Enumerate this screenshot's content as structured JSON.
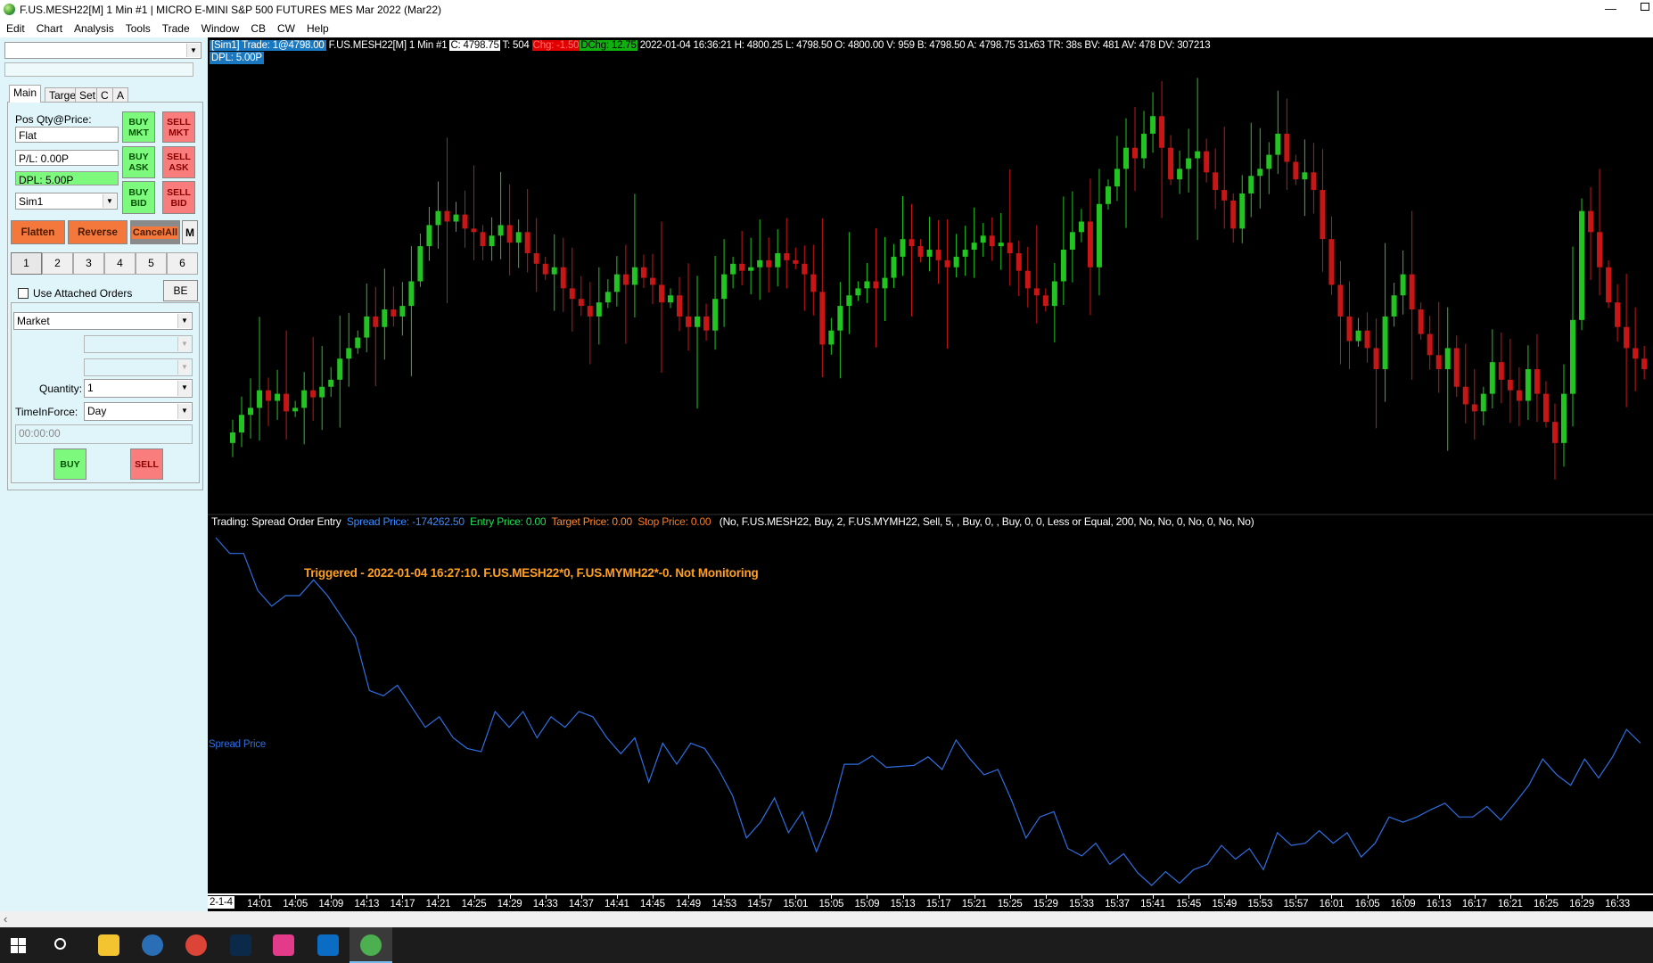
{
  "window": {
    "title": "F.US.MESH22[M]  1 Min   #1 | MICRO E-MINI S&P 500 FUTURES MES Mar 2022 (Mar22)"
  },
  "menu": [
    "Edit",
    "Chart",
    "Analysis",
    "Tools",
    "Trade",
    "Window",
    "CB",
    "CW",
    "Help"
  ],
  "panel": {
    "account_combo": "",
    "tabs": [
      "Main",
      "Targets",
      "Set",
      "C",
      "A"
    ],
    "pos_label": "Pos Qty@Price:",
    "pos_value": "Flat",
    "pl": "P/L: 0.00P",
    "dpl": "DPL: 5.00P",
    "account": "Sim1",
    "buy_mkt": [
      "BUY",
      "MKT"
    ],
    "sell_mkt": [
      "SELL",
      "MKT"
    ],
    "buy_ask": [
      "BUY",
      "ASK"
    ],
    "sell_ask": [
      "SELL",
      "ASK"
    ],
    "buy_bid": [
      "BUY",
      "BID"
    ],
    "sell_bid": [
      "SELL",
      "BID"
    ],
    "flatten": "Flatten",
    "reverse": "Reverse",
    "cancel_all": "CancelAll",
    "m": "M",
    "numbers": [
      "1",
      "2",
      "3",
      "4",
      "5",
      "6"
    ],
    "use_attached": "Use Attached Orders",
    "be": "BE",
    "order_type": "Market",
    "quantity_label": "Quantity:",
    "quantity": "1",
    "tif_label": "TimeInForce:",
    "tif": "Day",
    "time": "00:00:00",
    "buy": "BUY",
    "sell": "SELL"
  },
  "header": {
    "trade": "[Sim1]  Trade: 1@4798.00",
    "symbol": "F.US.MESH22[M]  1 Min   #1",
    "close": "C: 4798.75",
    "ticks": "T: 504",
    "chg": "Chg: -1.50",
    "dchg": "DChg: 12.75",
    "rest": "2022-01-04 16:36:21 H: 4800.25 L: 4798.50 O: 4800.00 V: 959 B: 4798.50 A: 4798.75 31x63 TR: 38s BV: 481 AV: 478 DV: 307213",
    "dpl": "DPL: 5.00P"
  },
  "trading": {
    "label": "Trading: Spread Order Entry",
    "spread": "Spread Price: -174262.50",
    "entry": "Entry Price: 0.00",
    "target": "Target Price: 0.00",
    "stop": "Stop Price: 0.00",
    "params": "(No, F.US.MESH22, Buy, 2, F.US.MYMH22, Sell, 5, , Buy, 0, , Buy, 0, 0, Less or Equal, 200, No, No, 0, No, 0, No, No)",
    "triggered": "Triggered - 2022-01-04  16:27:10. F.US.MESH22*0, F.US.MYMH22*-0. Not Monitoring",
    "series_label": "Spread Price"
  },
  "colors": {
    "up": "#22c422",
    "down": "#c81616",
    "spread": "#2f6fe0",
    "entry": "#22dd55",
    "target": "#ff8a33",
    "stop": "#ff7a1a",
    "triggered": "#ffa020"
  },
  "chart_data": [
    {
      "type": "candlestick",
      "title": "F.US.MESH22[M] 1 Min",
      "start_time": "13:58",
      "interval_min": 1,
      "ylim": [
        4790,
        4820
      ],
      "closes": [
        4794.25,
        4795.5,
        4796.0,
        4797.25,
        4796.5,
        4797.0,
        4795.75,
        4796.0,
        4797.25,
        4796.75,
        4797.5,
        4798.0,
        4799.5,
        4800.25,
        4801.0,
        4802.5,
        4801.75,
        4803.0,
        4802.5,
        4803.25,
        4805.0,
        4807.5,
        4809.0,
        4810.0,
        4809.25,
        4809.75,
        4808.75,
        4808.5,
        4807.5,
        4808.25,
        4809.0,
        4807.75,
        4808.5,
        4807.0,
        4806.25,
        4805.5,
        4806.0,
        4804.5,
        4803.75,
        4803.25,
        4802.5,
        4803.5,
        4804.25,
        4805.5,
        4804.75,
        4806.0,
        4805.25,
        4804.75,
        4803.5,
        4804.0,
        4802.5,
        4801.75,
        4802.5,
        4801.5,
        4803.75,
        4805.5,
        4806.25,
        4805.75,
        4806.0,
        4806.5,
        4806.0,
        4807.0,
        4806.5,
        4806.25,
        4805.5,
        4804.25,
        4800.5,
        4801.5,
        4803.25,
        4804.0,
        4804.5,
        4805.0,
        4804.5,
        4805.25,
        4806.75,
        4808.0,
        4807.5,
        4806.75,
        4807.25,
        4806.5,
        4806.0,
        4806.75,
        4807.25,
        4807.75,
        4808.25,
        4807.5,
        4807.75,
        4807.0,
        4805.75,
        4804.5,
        4804.0,
        4803.25,
        4805.0,
        4807.25,
        4808.5,
        4809.25,
        4806.0,
        4810.5,
        4811.75,
        4813.0,
        4814.5,
        4813.75,
        4815.5,
        4816.75,
        4814.5,
        4812.25,
        4813.0,
        4813.75,
        4814.25,
        4812.75,
        4811.5,
        4810.75,
        4808.75,
        4811.25,
        4812.5,
        4813.0,
        4814.0,
        4815.5,
        4813.5,
        4812.25,
        4812.75,
        4811.5,
        4808.0,
        4804.75,
        4802.5,
        4800.75,
        4801.5,
        4800.25,
        4798.75,
        4802.5,
        4804.0,
        4805.5,
        4803.0,
        4801.25,
        4799.75,
        4798.75,
        4800.25,
        4797.5,
        4796.25,
        4795.75,
        4797.0,
        4799.25,
        4798.0,
        4797.25,
        4796.5,
        4798.75,
        4797.0,
        4795.0,
        4793.5,
        4797.0,
        4802.25,
        4810.0,
        4808.5,
        4806.0,
        4803.5,
        4801.75,
        4800.25,
        4799.5,
        4798.75
      ]
    },
    {
      "type": "line",
      "name": "Spread Price",
      "ylim": [
        -174600,
        -173775
      ],
      "values": [
        -173775,
        -173812.5,
        -173812.5,
        -173900,
        -173937.5,
        -173912.5,
        -173912.5,
        -173875,
        -173912.5,
        -173962.5,
        -174012.5,
        -174137.5,
        -174150,
        -174125,
        -174175,
        -174225,
        -174200,
        -174250,
        -174275,
        -174282.5,
        -174187.5,
        -174225,
        -174187.5,
        -174250,
        -174200,
        -174225,
        -174187.5,
        -174200,
        -174250,
        -174287.5,
        -174250,
        -174355,
        -174262.5,
        -174312.5,
        -174262.5,
        -174275,
        -174325,
        -174387.5,
        -174487.5,
        -174450,
        -174392.5,
        -174475,
        -174425,
        -174520,
        -174437.5,
        -174312.5,
        -174312.5,
        -174292.5,
        -174320,
        -174317.5,
        -174315,
        -174295,
        -174325,
        -174255,
        -174300,
        -174337.5,
        -174325,
        -174400,
        -174487.5,
        -174437.5,
        -174425,
        -174512.5,
        -174530,
        -174500,
        -174550,
        -174525,
        -174570,
        -174600,
        -174567.5,
        -174595,
        -174562.5,
        -174550,
        -174505,
        -174537.5,
        -174512.5,
        -174562.5,
        -174475,
        -174505,
        -174500,
        -174470,
        -174500,
        -174475,
        -174532.5,
        -174500,
        -174437.5,
        -174450,
        -174437.5,
        -174420,
        -174405,
        -174437.5,
        -174437.5,
        -174412.5,
        -174445,
        -174405,
        -174362.5,
        -174300,
        -174337.5,
        -174362.5,
        -174300,
        -174345,
        -174295,
        -174230,
        -174262.5
      ]
    },
    {
      "type": "axis",
      "date_label": "2-1-4",
      "ticks": [
        "14:01",
        "14:05",
        "14:09",
        "14:13",
        "14:17",
        "14:21",
        "14:25",
        "14:29",
        "14:33",
        "14:37",
        "14:41",
        "14:45",
        "14:49",
        "14:53",
        "14:57",
        "15:01",
        "15:05",
        "15:09",
        "15:13",
        "15:17",
        "15:21",
        "15:25",
        "15:29",
        "15:33",
        "15:37",
        "15:41",
        "15:45",
        "15:49",
        "15:53",
        "15:57",
        "16:01",
        "16:05",
        "16:09",
        "16:13",
        "16:17",
        "16:21",
        "16:25",
        "16:29",
        "16:33"
      ]
    }
  ],
  "taskbar": [
    "windows-start",
    "search",
    "file-explorer",
    "edge",
    "chrome",
    "photoshop",
    "creative-cloud",
    "app-o",
    "trading-app"
  ]
}
